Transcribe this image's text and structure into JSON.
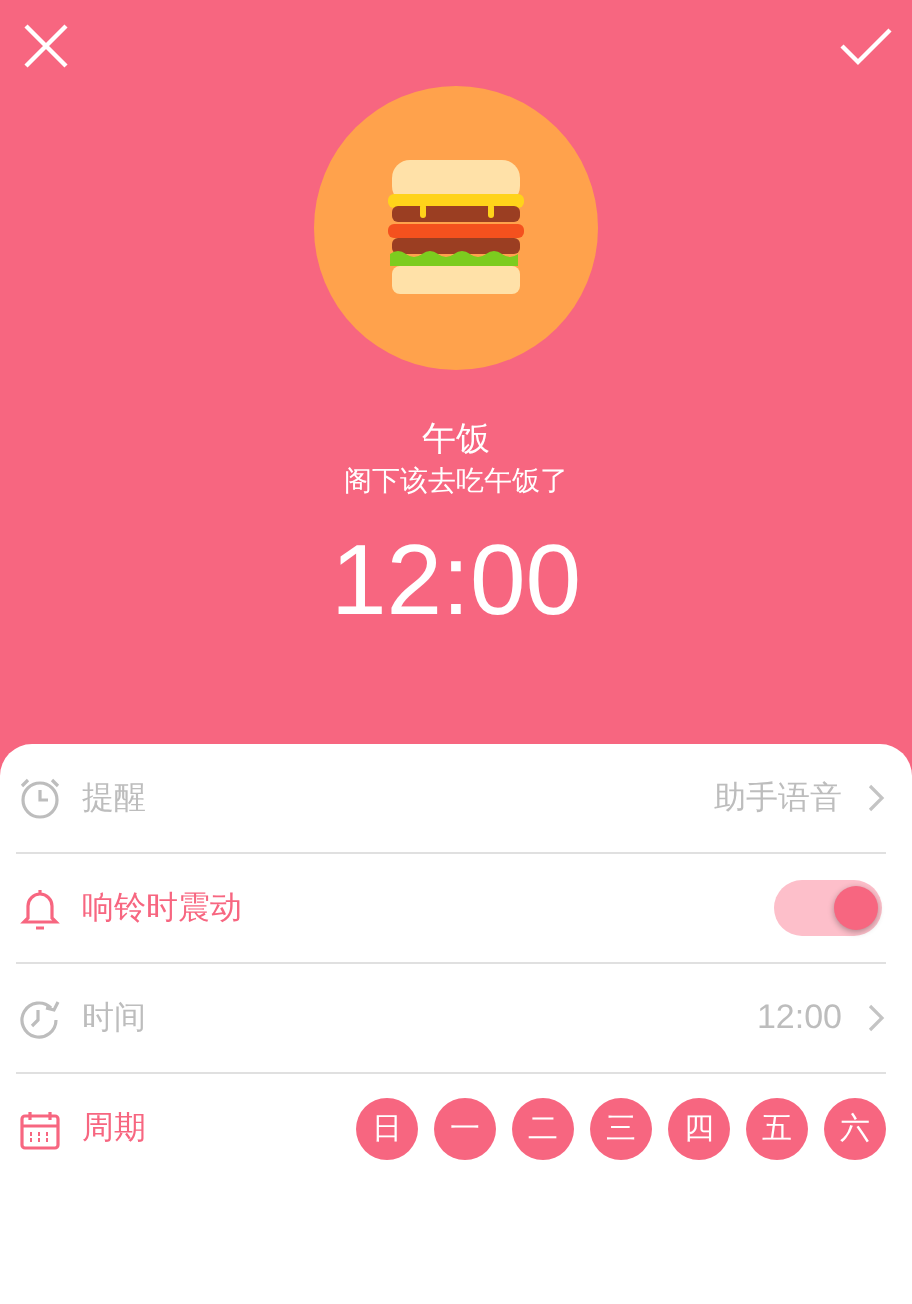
{
  "header": {
    "title": "午饭",
    "subtitle": "阁下该去吃午饭了",
    "time": "12:00"
  },
  "rows": [
    {
      "kind": "link",
      "label": "提醒",
      "value": "助手语音",
      "active": false
    },
    {
      "kind": "toggle",
      "label": "响铃时震动",
      "on": true,
      "active": true
    },
    {
      "kind": "link",
      "label": "时间",
      "value": "12:00",
      "active": false
    },
    {
      "kind": "days",
      "label": "周期",
      "active": true,
      "days": [
        {
          "label": "日",
          "selected": true
        },
        {
          "label": "一",
          "selected": true
        },
        {
          "label": "二",
          "selected": true
        },
        {
          "label": "三",
          "selected": true
        },
        {
          "label": "四",
          "selected": true
        },
        {
          "label": "五",
          "selected": true
        },
        {
          "label": "六",
          "selected": true
        }
      ]
    }
  ]
}
